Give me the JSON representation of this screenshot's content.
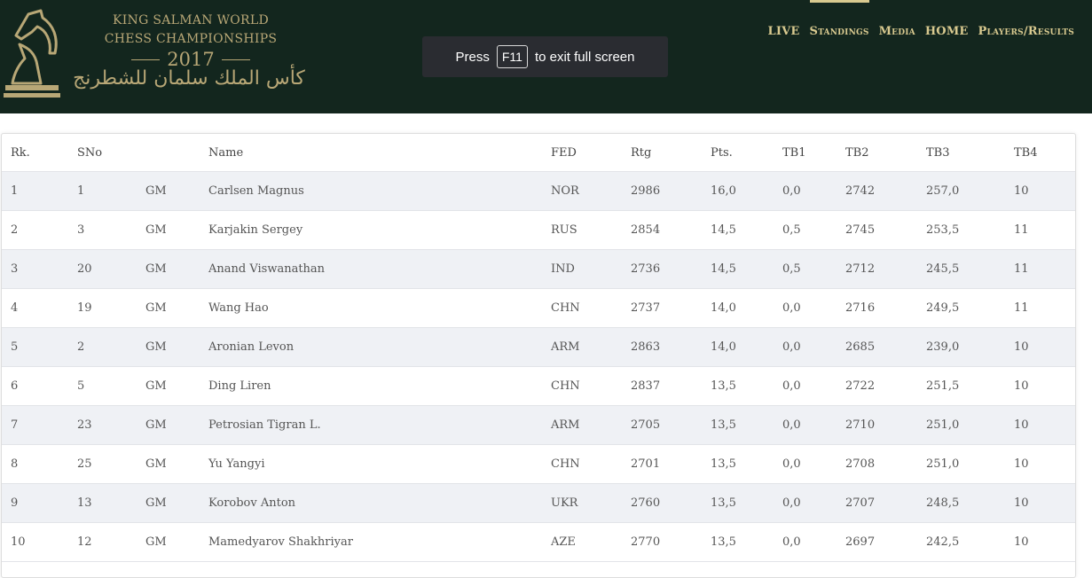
{
  "header": {
    "brand_line1": "KING SALMAN WORLD",
    "brand_line2": "CHESS CHAMPIONSHIPS",
    "brand_year": "2017",
    "brand_arabic": "كأس الملك سلمان للشطرنج",
    "logo_icon": "chess-knight-icon",
    "colors": {
      "background": "#13261e",
      "gold": "#b8a776",
      "nav": "#d8c98f"
    }
  },
  "toast": {
    "prefix": "Press",
    "key": "F11",
    "suffix": "to exit full screen"
  },
  "nav": {
    "active": "Standings",
    "items": [
      "LIVE",
      "Standings",
      "Media",
      "HOME",
      "Players/Results"
    ]
  },
  "table": {
    "columns": [
      "Rk.",
      "SNo",
      "",
      "Name",
      "FED",
      "Rtg",
      "Pts.",
      "TB1",
      "TB2",
      "TB3",
      "TB4"
    ],
    "rows": [
      [
        "1",
        "1",
        "GM",
        "Carlsen Magnus",
        "NOR",
        "2986",
        "16,0",
        "0,0",
        "2742",
        "257,0",
        "10"
      ],
      [
        "2",
        "3",
        "GM",
        "Karjakin Sergey",
        "RUS",
        "2854",
        "14,5",
        "0,5",
        "2745",
        "253,5",
        "11"
      ],
      [
        "3",
        "20",
        "GM",
        "Anand Viswanathan",
        "IND",
        "2736",
        "14,5",
        "0,5",
        "2712",
        "245,5",
        "11"
      ],
      [
        "4",
        "19",
        "GM",
        "Wang Hao",
        "CHN",
        "2737",
        "14,0",
        "0,0",
        "2716",
        "249,5",
        "11"
      ],
      [
        "5",
        "2",
        "GM",
        "Aronian Levon",
        "ARM",
        "2863",
        "14,0",
        "0,0",
        "2685",
        "239,0",
        "10"
      ],
      [
        "6",
        "5",
        "GM",
        "Ding Liren",
        "CHN",
        "2837",
        "13,5",
        "0,0",
        "2722",
        "251,5",
        "10"
      ],
      [
        "7",
        "23",
        "GM",
        "Petrosian Tigran L.",
        "ARM",
        "2705",
        "13,5",
        "0,0",
        "2710",
        "251,0",
        "10"
      ],
      [
        "8",
        "25",
        "GM",
        "Yu Yangyi",
        "CHN",
        "2701",
        "13,5",
        "0,0",
        "2708",
        "251,0",
        "10"
      ],
      [
        "9",
        "13",
        "GM",
        "Korobov Anton",
        "UKR",
        "2760",
        "13,5",
        "0,0",
        "2707",
        "248,5",
        "10"
      ],
      [
        "10",
        "12",
        "GM",
        "Mamedyarov Shakhriyar",
        "AZE",
        "2770",
        "13,5",
        "0,0",
        "2697",
        "242,5",
        "10"
      ]
    ]
  }
}
